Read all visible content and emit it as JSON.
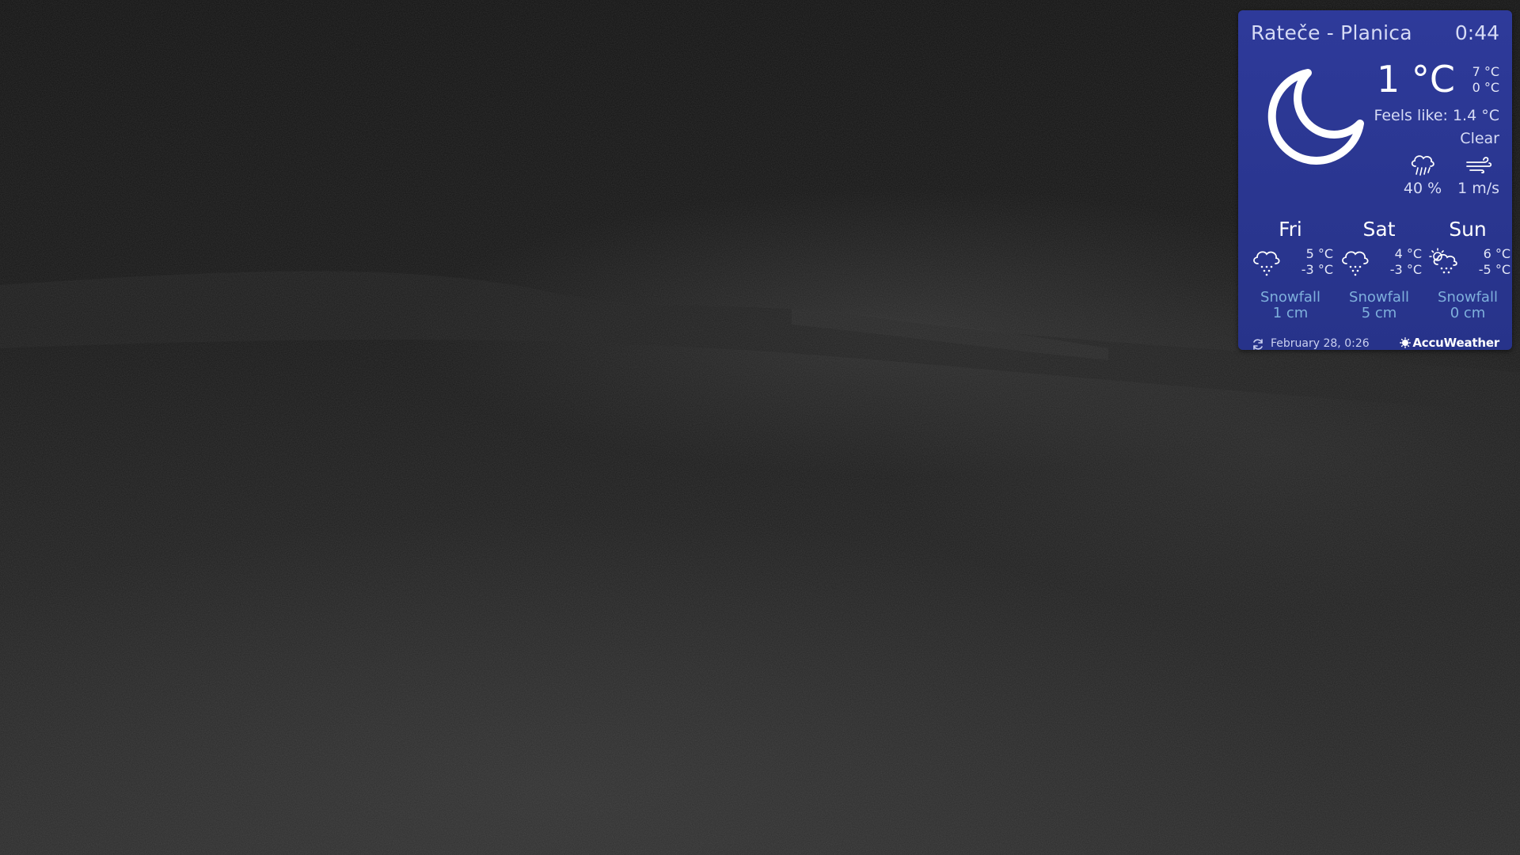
{
  "widget": {
    "location": "Rateče - Planica",
    "time": "0:44",
    "current": {
      "temperature": "1 °C",
      "high": "7 °C",
      "low": "0 °C",
      "feels_like": "Feels like: 1.4 °C",
      "condition": "Clear",
      "condition_icon": "moon-crescent-icon",
      "precip_probability": "40 %",
      "precip_icon": "rain-cloud-icon",
      "wind": "1 m/s",
      "wind_icon": "wind-icon"
    },
    "forecast": [
      {
        "day": "Fri",
        "high": "5 °C",
        "low": "-3 °C",
        "precip_label": "Snowfall",
        "precip_value": "1 cm",
        "icon": "snow-cloud-icon"
      },
      {
        "day": "Sat",
        "high": "4 °C",
        "low": "-3 °C",
        "precip_label": "Snowfall",
        "precip_value": "5 cm",
        "icon": "snow-cloud-icon"
      },
      {
        "day": "Sun",
        "high": "6 °C",
        "low": "-5 °C",
        "precip_label": "Snowfall",
        "precip_value": "0 cm",
        "icon": "sun-snow-cloud-icon"
      }
    ],
    "updated": "February 28, 0:26",
    "updated_icon": "refresh-icon",
    "brand": "AccuWeather",
    "colors": {
      "panel": "#2b3792",
      "accent_text": "#7fb0dc"
    }
  }
}
